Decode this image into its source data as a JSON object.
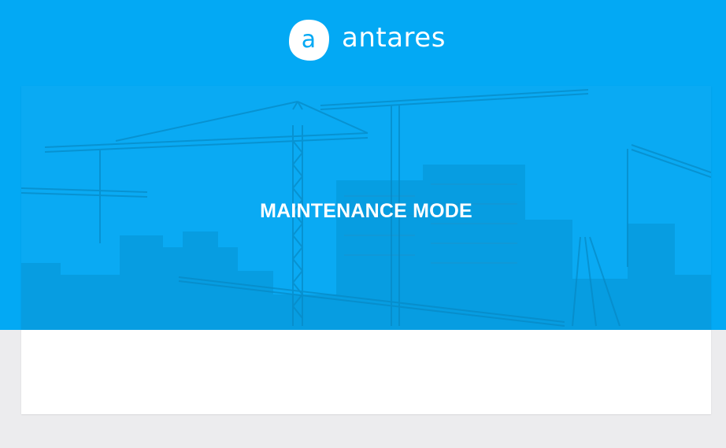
{
  "header": {
    "logo_text": "antares",
    "logo_mark_letter": "a",
    "logo_icon": "antares-logo-icon"
  },
  "maintenance": {
    "title": "MAINTENANCE MODE",
    "illustration": "construction-cranes-skyline-illustration"
  },
  "colors": {
    "brand_blue": "#03a9f4",
    "hero_blue": "#0aaaf3",
    "page_background": "#ececee",
    "card_background": "#ffffff",
    "text_on_blue": "#ffffff"
  }
}
